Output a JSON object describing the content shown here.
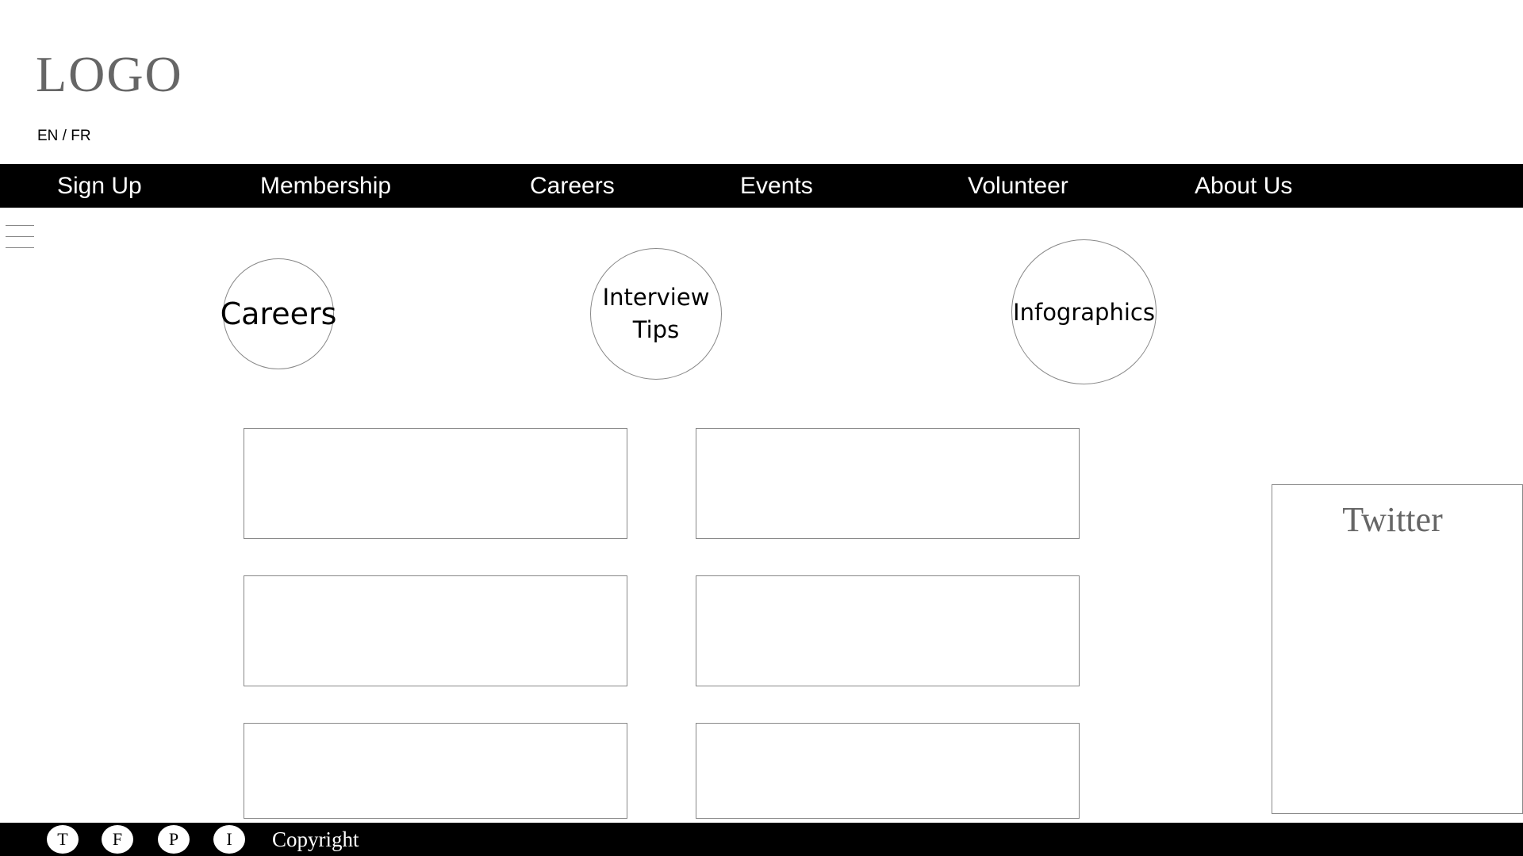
{
  "header": {
    "logo_text": "LOGO",
    "language_toggle": "EN / FR"
  },
  "nav": {
    "items": [
      {
        "label": "Sign Up"
      },
      {
        "label": "Membership"
      },
      {
        "label": "Careers"
      },
      {
        "label": "Events"
      },
      {
        "label": "Volunteer"
      },
      {
        "label": "About Us"
      }
    ]
  },
  "menu_icon": "hamburger-icon",
  "features": [
    {
      "label": "Careers"
    },
    {
      "label": "Interview\nTips"
    },
    {
      "label": "Infographics"
    }
  ],
  "twitter": {
    "title": "Twitter"
  },
  "footer": {
    "social": [
      {
        "letter": "T",
        "icon": "twitter-icon"
      },
      {
        "letter": "F",
        "icon": "facebook-icon"
      },
      {
        "letter": "P",
        "icon": "pinterest-icon"
      },
      {
        "letter": "I",
        "icon": "instagram-icon"
      }
    ],
    "copyright": "Copyright"
  }
}
